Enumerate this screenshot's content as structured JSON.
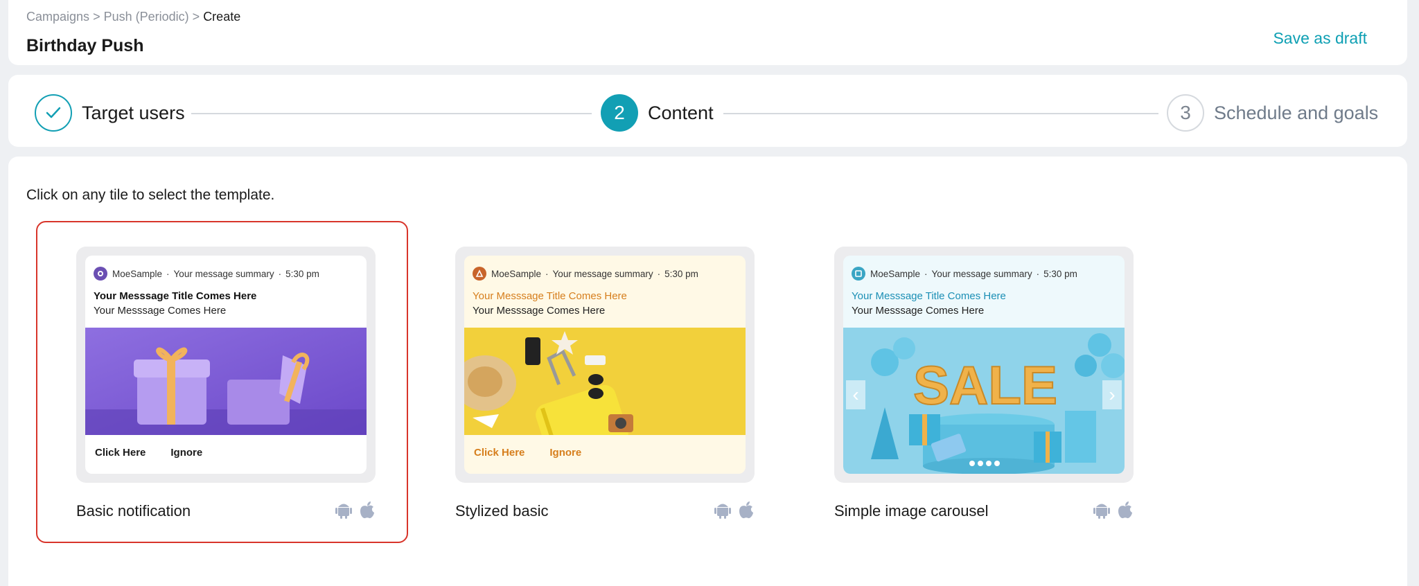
{
  "breadcrumb": {
    "items": [
      "Campaigns",
      "Push (Periodic)",
      "Create"
    ],
    "separator": ">"
  },
  "page_title": "Birthday Push",
  "save_draft_label": "Save as draft",
  "stepper": {
    "steps": [
      {
        "number": "1",
        "label": "Target users",
        "state": "completed"
      },
      {
        "number": "2",
        "label": "Content",
        "state": "active"
      },
      {
        "number": "3",
        "label": "Schedule and goals",
        "state": "pending"
      }
    ]
  },
  "instructions": "Click on any tile to select the template.",
  "templates": [
    {
      "name": "Basic notification",
      "selected": true,
      "app_name": "MoeSample",
      "summary": "Your message summary",
      "time": "5:30 pm",
      "title": "Your Messsage Title Comes Here",
      "body": "Your Messsage Comes Here",
      "actions": [
        "Click Here",
        "Ignore"
      ],
      "os": [
        "android-icon",
        "apple-icon"
      ]
    },
    {
      "name": "Stylized basic",
      "selected": false,
      "app_name": "MoeSample",
      "summary": "Your message summary",
      "time": "5:30 pm",
      "title": "Your Messsage Title Comes Here",
      "body": "Your Messsage Comes Here",
      "actions": [
        "Click Here",
        "Ignore"
      ],
      "os": [
        "android-icon",
        "apple-icon"
      ]
    },
    {
      "name": "Simple image carousel",
      "selected": false,
      "app_name": "MoeSample",
      "summary": "Your message summary",
      "time": "5:30 pm",
      "title": "Your Messsage Title Comes Here",
      "body": "Your Messsage Comes Here",
      "carousel_text": "SALE",
      "os": [
        "android-icon",
        "apple-icon"
      ]
    }
  ],
  "colors": {
    "accent": "#129fb4",
    "selected_outline": "#d8342a",
    "stylized_accent": "#d67e1c",
    "carousel_title": "#1b8fb5"
  }
}
